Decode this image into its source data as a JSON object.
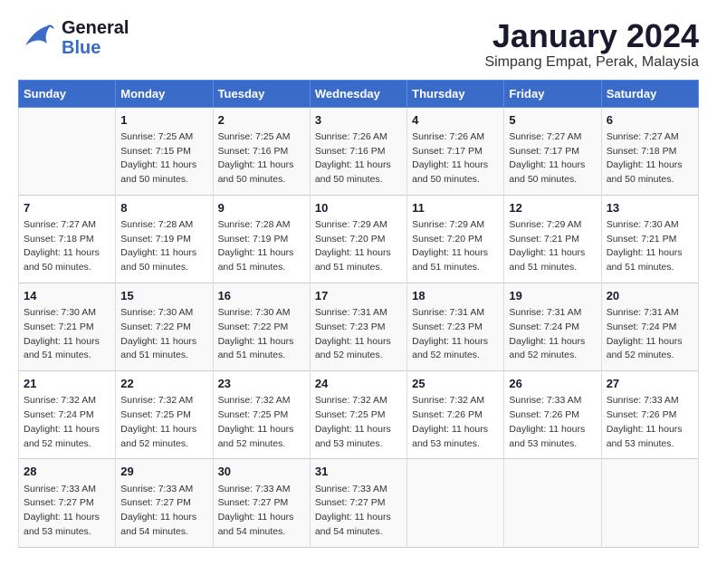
{
  "logo": {
    "line1": "General",
    "line2": "Blue"
  },
  "title": "January 2024",
  "subtitle": "Simpang Empat, Perak, Malaysia",
  "days_of_week": [
    "Sunday",
    "Monday",
    "Tuesday",
    "Wednesday",
    "Thursday",
    "Friday",
    "Saturday"
  ],
  "weeks": [
    [
      {
        "day": "",
        "sunrise": "",
        "sunset": "",
        "daylight": ""
      },
      {
        "day": "1",
        "sunrise": "Sunrise: 7:25 AM",
        "sunset": "Sunset: 7:15 PM",
        "daylight": "Daylight: 11 hours and 50 minutes."
      },
      {
        "day": "2",
        "sunrise": "Sunrise: 7:25 AM",
        "sunset": "Sunset: 7:16 PM",
        "daylight": "Daylight: 11 hours and 50 minutes."
      },
      {
        "day": "3",
        "sunrise": "Sunrise: 7:26 AM",
        "sunset": "Sunset: 7:16 PM",
        "daylight": "Daylight: 11 hours and 50 minutes."
      },
      {
        "day": "4",
        "sunrise": "Sunrise: 7:26 AM",
        "sunset": "Sunset: 7:17 PM",
        "daylight": "Daylight: 11 hours and 50 minutes."
      },
      {
        "day": "5",
        "sunrise": "Sunrise: 7:27 AM",
        "sunset": "Sunset: 7:17 PM",
        "daylight": "Daylight: 11 hours and 50 minutes."
      },
      {
        "day": "6",
        "sunrise": "Sunrise: 7:27 AM",
        "sunset": "Sunset: 7:18 PM",
        "daylight": "Daylight: 11 hours and 50 minutes."
      }
    ],
    [
      {
        "day": "7",
        "sunrise": "Sunrise: 7:27 AM",
        "sunset": "Sunset: 7:18 PM",
        "daylight": "Daylight: 11 hours and 50 minutes."
      },
      {
        "day": "8",
        "sunrise": "Sunrise: 7:28 AM",
        "sunset": "Sunset: 7:19 PM",
        "daylight": "Daylight: 11 hours and 50 minutes."
      },
      {
        "day": "9",
        "sunrise": "Sunrise: 7:28 AM",
        "sunset": "Sunset: 7:19 PM",
        "daylight": "Daylight: 11 hours and 51 minutes."
      },
      {
        "day": "10",
        "sunrise": "Sunrise: 7:29 AM",
        "sunset": "Sunset: 7:20 PM",
        "daylight": "Daylight: 11 hours and 51 minutes."
      },
      {
        "day": "11",
        "sunrise": "Sunrise: 7:29 AM",
        "sunset": "Sunset: 7:20 PM",
        "daylight": "Daylight: 11 hours and 51 minutes."
      },
      {
        "day": "12",
        "sunrise": "Sunrise: 7:29 AM",
        "sunset": "Sunset: 7:21 PM",
        "daylight": "Daylight: 11 hours and 51 minutes."
      },
      {
        "day": "13",
        "sunrise": "Sunrise: 7:30 AM",
        "sunset": "Sunset: 7:21 PM",
        "daylight": "Daylight: 11 hours and 51 minutes."
      }
    ],
    [
      {
        "day": "14",
        "sunrise": "Sunrise: 7:30 AM",
        "sunset": "Sunset: 7:21 PM",
        "daylight": "Daylight: 11 hours and 51 minutes."
      },
      {
        "day": "15",
        "sunrise": "Sunrise: 7:30 AM",
        "sunset": "Sunset: 7:22 PM",
        "daylight": "Daylight: 11 hours and 51 minutes."
      },
      {
        "day": "16",
        "sunrise": "Sunrise: 7:30 AM",
        "sunset": "Sunset: 7:22 PM",
        "daylight": "Daylight: 11 hours and 51 minutes."
      },
      {
        "day": "17",
        "sunrise": "Sunrise: 7:31 AM",
        "sunset": "Sunset: 7:23 PM",
        "daylight": "Daylight: 11 hours and 52 minutes."
      },
      {
        "day": "18",
        "sunrise": "Sunrise: 7:31 AM",
        "sunset": "Sunset: 7:23 PM",
        "daylight": "Daylight: 11 hours and 52 minutes."
      },
      {
        "day": "19",
        "sunrise": "Sunrise: 7:31 AM",
        "sunset": "Sunset: 7:24 PM",
        "daylight": "Daylight: 11 hours and 52 minutes."
      },
      {
        "day": "20",
        "sunrise": "Sunrise: 7:31 AM",
        "sunset": "Sunset: 7:24 PM",
        "daylight": "Daylight: 11 hours and 52 minutes."
      }
    ],
    [
      {
        "day": "21",
        "sunrise": "Sunrise: 7:32 AM",
        "sunset": "Sunset: 7:24 PM",
        "daylight": "Daylight: 11 hours and 52 minutes."
      },
      {
        "day": "22",
        "sunrise": "Sunrise: 7:32 AM",
        "sunset": "Sunset: 7:25 PM",
        "daylight": "Daylight: 11 hours and 52 minutes."
      },
      {
        "day": "23",
        "sunrise": "Sunrise: 7:32 AM",
        "sunset": "Sunset: 7:25 PM",
        "daylight": "Daylight: 11 hours and 52 minutes."
      },
      {
        "day": "24",
        "sunrise": "Sunrise: 7:32 AM",
        "sunset": "Sunset: 7:25 PM",
        "daylight": "Daylight: 11 hours and 53 minutes."
      },
      {
        "day": "25",
        "sunrise": "Sunrise: 7:32 AM",
        "sunset": "Sunset: 7:26 PM",
        "daylight": "Daylight: 11 hours and 53 minutes."
      },
      {
        "day": "26",
        "sunrise": "Sunrise: 7:33 AM",
        "sunset": "Sunset: 7:26 PM",
        "daylight": "Daylight: 11 hours and 53 minutes."
      },
      {
        "day": "27",
        "sunrise": "Sunrise: 7:33 AM",
        "sunset": "Sunset: 7:26 PM",
        "daylight": "Daylight: 11 hours and 53 minutes."
      }
    ],
    [
      {
        "day": "28",
        "sunrise": "Sunrise: 7:33 AM",
        "sunset": "Sunset: 7:27 PM",
        "daylight": "Daylight: 11 hours and 53 minutes."
      },
      {
        "day": "29",
        "sunrise": "Sunrise: 7:33 AM",
        "sunset": "Sunset: 7:27 PM",
        "daylight": "Daylight: 11 hours and 54 minutes."
      },
      {
        "day": "30",
        "sunrise": "Sunrise: 7:33 AM",
        "sunset": "Sunset: 7:27 PM",
        "daylight": "Daylight: 11 hours and 54 minutes."
      },
      {
        "day": "31",
        "sunrise": "Sunrise: 7:33 AM",
        "sunset": "Sunset: 7:27 PM",
        "daylight": "Daylight: 11 hours and 54 minutes."
      },
      {
        "day": "",
        "sunrise": "",
        "sunset": "",
        "daylight": ""
      },
      {
        "day": "",
        "sunrise": "",
        "sunset": "",
        "daylight": ""
      },
      {
        "day": "",
        "sunrise": "",
        "sunset": "",
        "daylight": ""
      }
    ]
  ]
}
